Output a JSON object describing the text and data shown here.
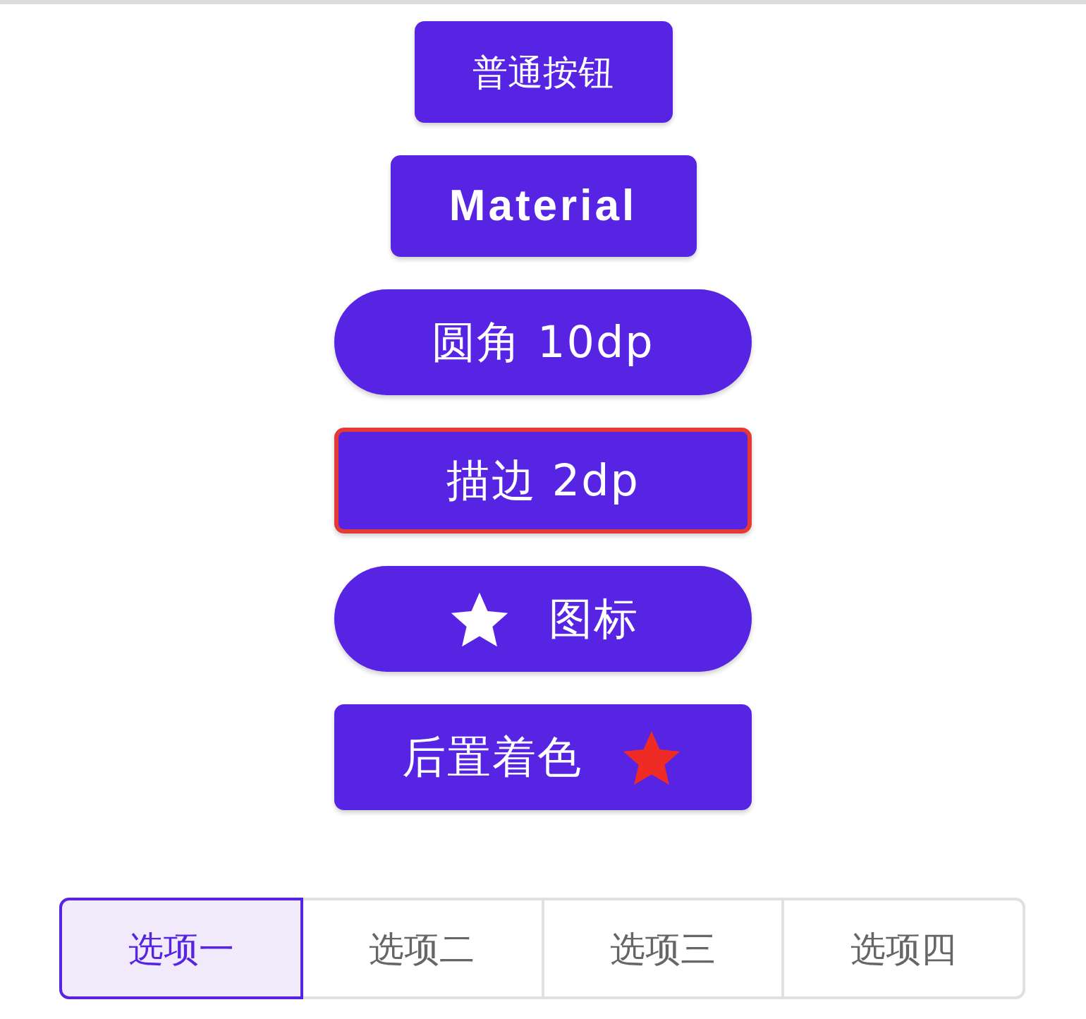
{
  "buttons": [
    {
      "kind": "plain",
      "label": "普通按钮"
    },
    {
      "kind": "material",
      "label": "Material"
    },
    {
      "kind": "rounded",
      "label": "圆角 10dp"
    },
    {
      "kind": "stroked",
      "label": "描边 2dp"
    },
    {
      "kind": "icon_start",
      "label": "图标"
    },
    {
      "kind": "icon_end",
      "label": "后置着色",
      "color": "#ee2b24"
    }
  ],
  "toggle_group": [
    {
      "label": "选项一",
      "selected": true
    },
    {
      "label": "选项二",
      "selected": false
    },
    {
      "label": "选项三",
      "selected": false
    },
    {
      "label": "选项四",
      "selected": false
    }
  ]
}
